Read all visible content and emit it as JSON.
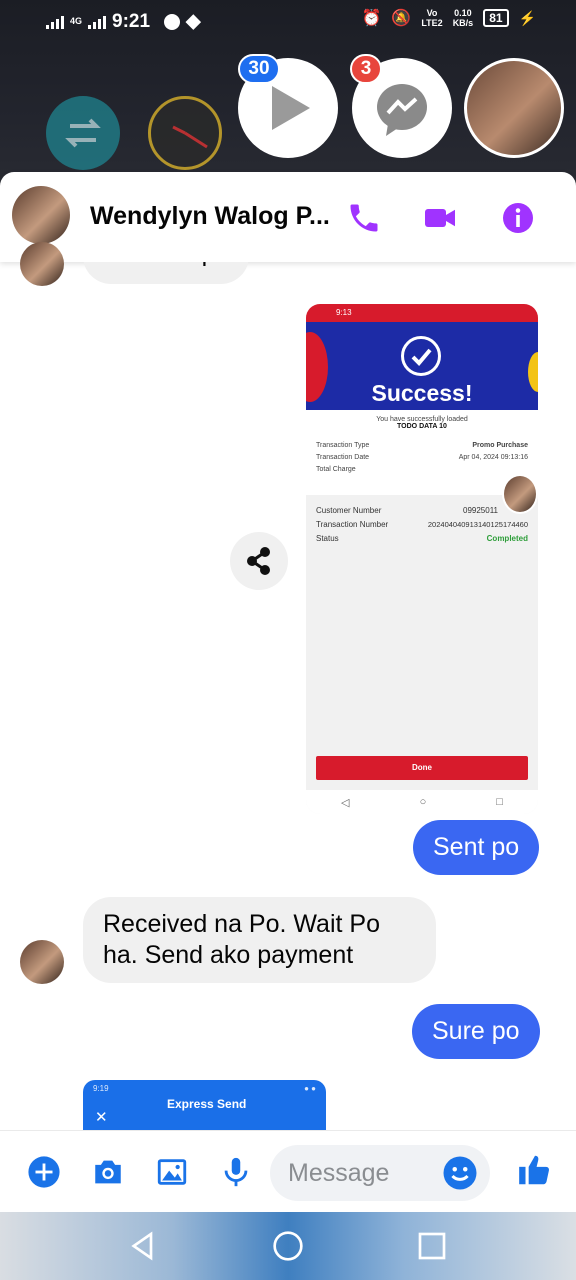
{
  "status_bar": {
    "time": "9:21",
    "network_label": "4G",
    "volte_label_1": "Vo",
    "volte_label_2": "LTE2",
    "speed_value": "0.10",
    "speed_unit": "KB/s",
    "battery": "81"
  },
  "chat_heads": {
    "play_badge": "30",
    "messenger_badge": "3"
  },
  "header": {
    "name": "Wendylyn Walog P..."
  },
  "messages": {
    "partial_top": "Salamat po",
    "sent_1": "Sent po",
    "received_1": "Received na Po. Wait Po ha. Send ako payment",
    "sent_2": "Sure po"
  },
  "receipt": {
    "status_time": "9:13",
    "title": "Success!",
    "subtitle": "You have successfully loaded",
    "product": "TODO DATA 10",
    "rows": [
      {
        "label": "Transaction Type",
        "value": "Promo Purchase"
      },
      {
        "label": "Transaction Date",
        "value": "Apr 04, 2024 09:13:16"
      },
      {
        "label": "Total Charge",
        "value": ""
      }
    ],
    "customer_number_label": "Customer Number",
    "customer_number_value": "09925011",
    "transaction_number_label": "Transaction Number",
    "transaction_number_value": "202404040913140125174460",
    "status_label": "Status",
    "status_value": "Completed",
    "done_label": "Done"
  },
  "partial_screenshot": {
    "status_time": "9:19",
    "title": "Express Send"
  },
  "composer": {
    "placeholder": "Message"
  },
  "colors": {
    "accent": "#3a67f2",
    "header_icons": "#a033ff",
    "composer_icons": "#1a73e8"
  }
}
